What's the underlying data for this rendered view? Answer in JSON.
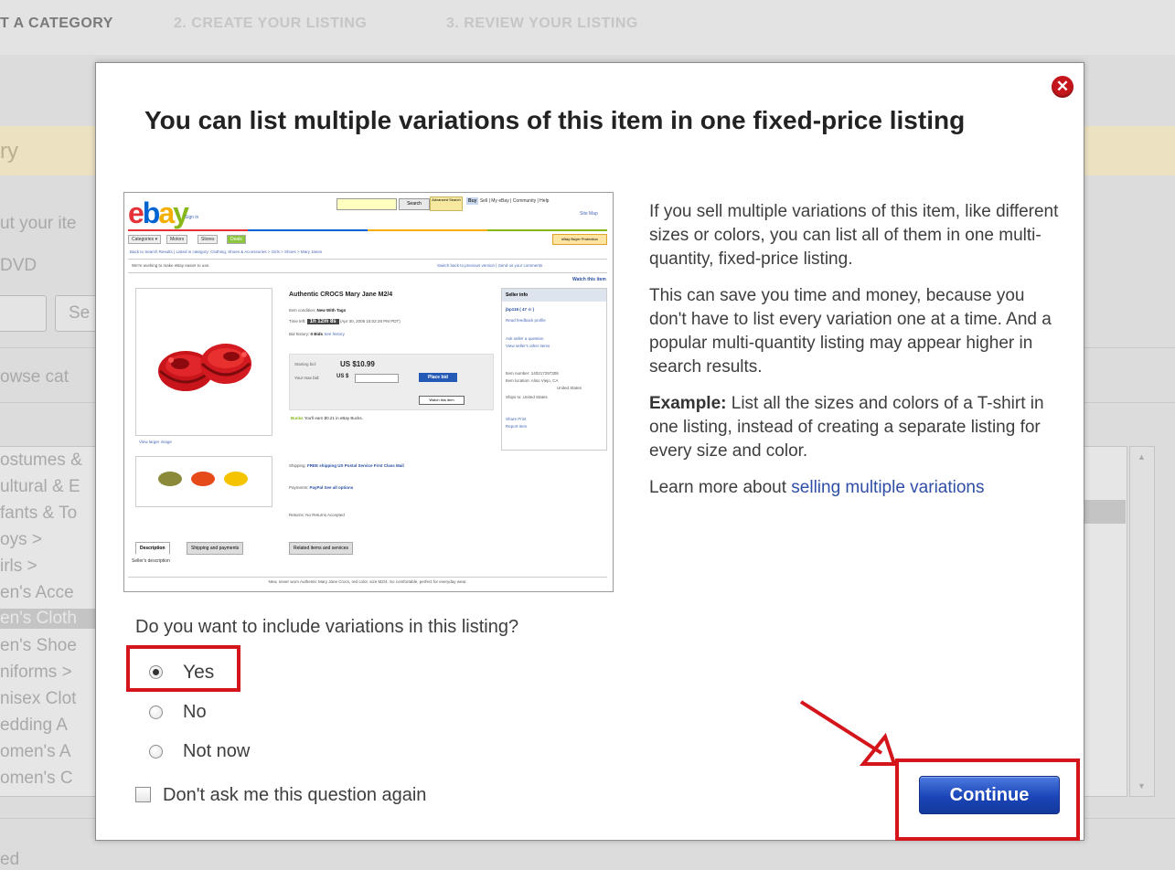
{
  "background": {
    "steps": [
      "T A CATEGORY",
      "2. CREATE YOUR LISTING",
      "3. REVIEW YOUR LISTING"
    ],
    "band_text": "ry",
    "labels": [
      "ut your ite",
      "DVD",
      "Se",
      "owse cat"
    ],
    "list_items": [
      "ostumes &",
      "ultural & E",
      "fants & To",
      "oys >",
      "irls >",
      "en's Acce",
      "en's Cloth",
      "en's Shoe",
      "niforms >",
      "nisex Clot",
      "edding A",
      "omen's A",
      "omen's C"
    ],
    "selected_index": 6,
    "footer_text": "ed"
  },
  "modal": {
    "title": "You can list multiple variations of this item in one fixed-price listing",
    "close_icon": "close-circle-icon",
    "screenshot": {
      "logo": [
        "e",
        "b",
        "a",
        "y"
      ],
      "sign_in": "Sign in",
      "search_button": "Search",
      "advanced_search": "Advanced Search",
      "nav": [
        "Buy",
        "Sell",
        "My eBay",
        "Community",
        "Help"
      ],
      "site_map": "Site Map",
      "tabs": [
        "Categories ▾",
        "Motors",
        "Stores",
        "Deals"
      ],
      "buyer_protection": "eBay Buyer Protection",
      "breadcrumb": "Back to Search Results | Listed in category: Clothing, Shoes & Accessories > Girls > Shoes > Mary Janes",
      "notice_left": "We're working to make eBay easier to use.",
      "notice_right": "Switch back to previous version | Send us your comments",
      "watch_item": "Watch this item",
      "item_title": "Authentic CROCS Mary Jane M2/4",
      "rows": [
        {
          "label": "Item condition:",
          "value": "New With Tags"
        },
        {
          "label": "Time left:",
          "value": "1h 12m 8s",
          "extra": "(Apr 30, 2008 15:02:28 PM PDT)"
        },
        {
          "label": "Bid history:",
          "value": "0 Bids",
          "extra": "See history"
        }
      ],
      "starting_bid_label": "Starting bid:",
      "starting_bid": "US $10.99",
      "your_max_bid_label": "Your max bid:",
      "currency": "US $",
      "place_bid": "Place bid",
      "watch_button": "Watch this item",
      "earn": "You'll earn $0.21 in eBay Bucks.",
      "earn_badge": "Bucks",
      "seller_info": "Seller info",
      "seller_lines": [
        "jbp118 ( 47 ☆ )",
        "Read feedback profile",
        "Ask seller a question",
        "View seller's other items",
        "Item number: 140217297308",
        "Item location: Aliso Viejo, CA",
        "United States",
        "Ships to: United States"
      ],
      "share_print": "Share  Print",
      "report_item": "Report item",
      "view_larger": "View larger image",
      "shipping_label": "Shipping:",
      "shipping_value": "FREE shipping US Postal Service First Class Mail",
      "payments_label": "Payments:",
      "payments_value": "PayPal  See all options",
      "returns_label": "Returns:",
      "returns_value": "No Returns Accepted",
      "bottom_tabs": [
        "Description",
        "Shipping and payments",
        "Related items and services"
      ],
      "seller_desc": "Seller's description",
      "desc_line": "New, never worn Authentic Mary Jane Crocs, red color, size M2/4. So comfortable, perfect for everyday wear."
    },
    "description": {
      "p1": "If you sell multiple variations of this item, like different sizes or colors, you can list all of them in one multi-quantity, fixed-price listing.",
      "p2": "This can save you time and money, because you don't have to list every variation one at a time. And a popular multi-quantity listing may appear higher in search results.",
      "example_label": "Example:",
      "example_text": "List all the sizes and colors of a T-shirt in one listing, instead of creating a separate listing for every size and color.",
      "learn_prefix": "Learn more about",
      "learn_link": "selling multiple variations"
    },
    "question": "Do you want to include variations in this listing?",
    "options": [
      {
        "label": "Yes",
        "checked": true
      },
      {
        "label": "No",
        "checked": false
      },
      {
        "label": "Not now",
        "checked": false
      }
    ],
    "dont_ask": "Don't ask me this question again",
    "continue": "Continue"
  },
  "colors": {
    "highlight": "#d4161c",
    "button_blue": "#1a45b8",
    "link": "#2f4ea6"
  }
}
